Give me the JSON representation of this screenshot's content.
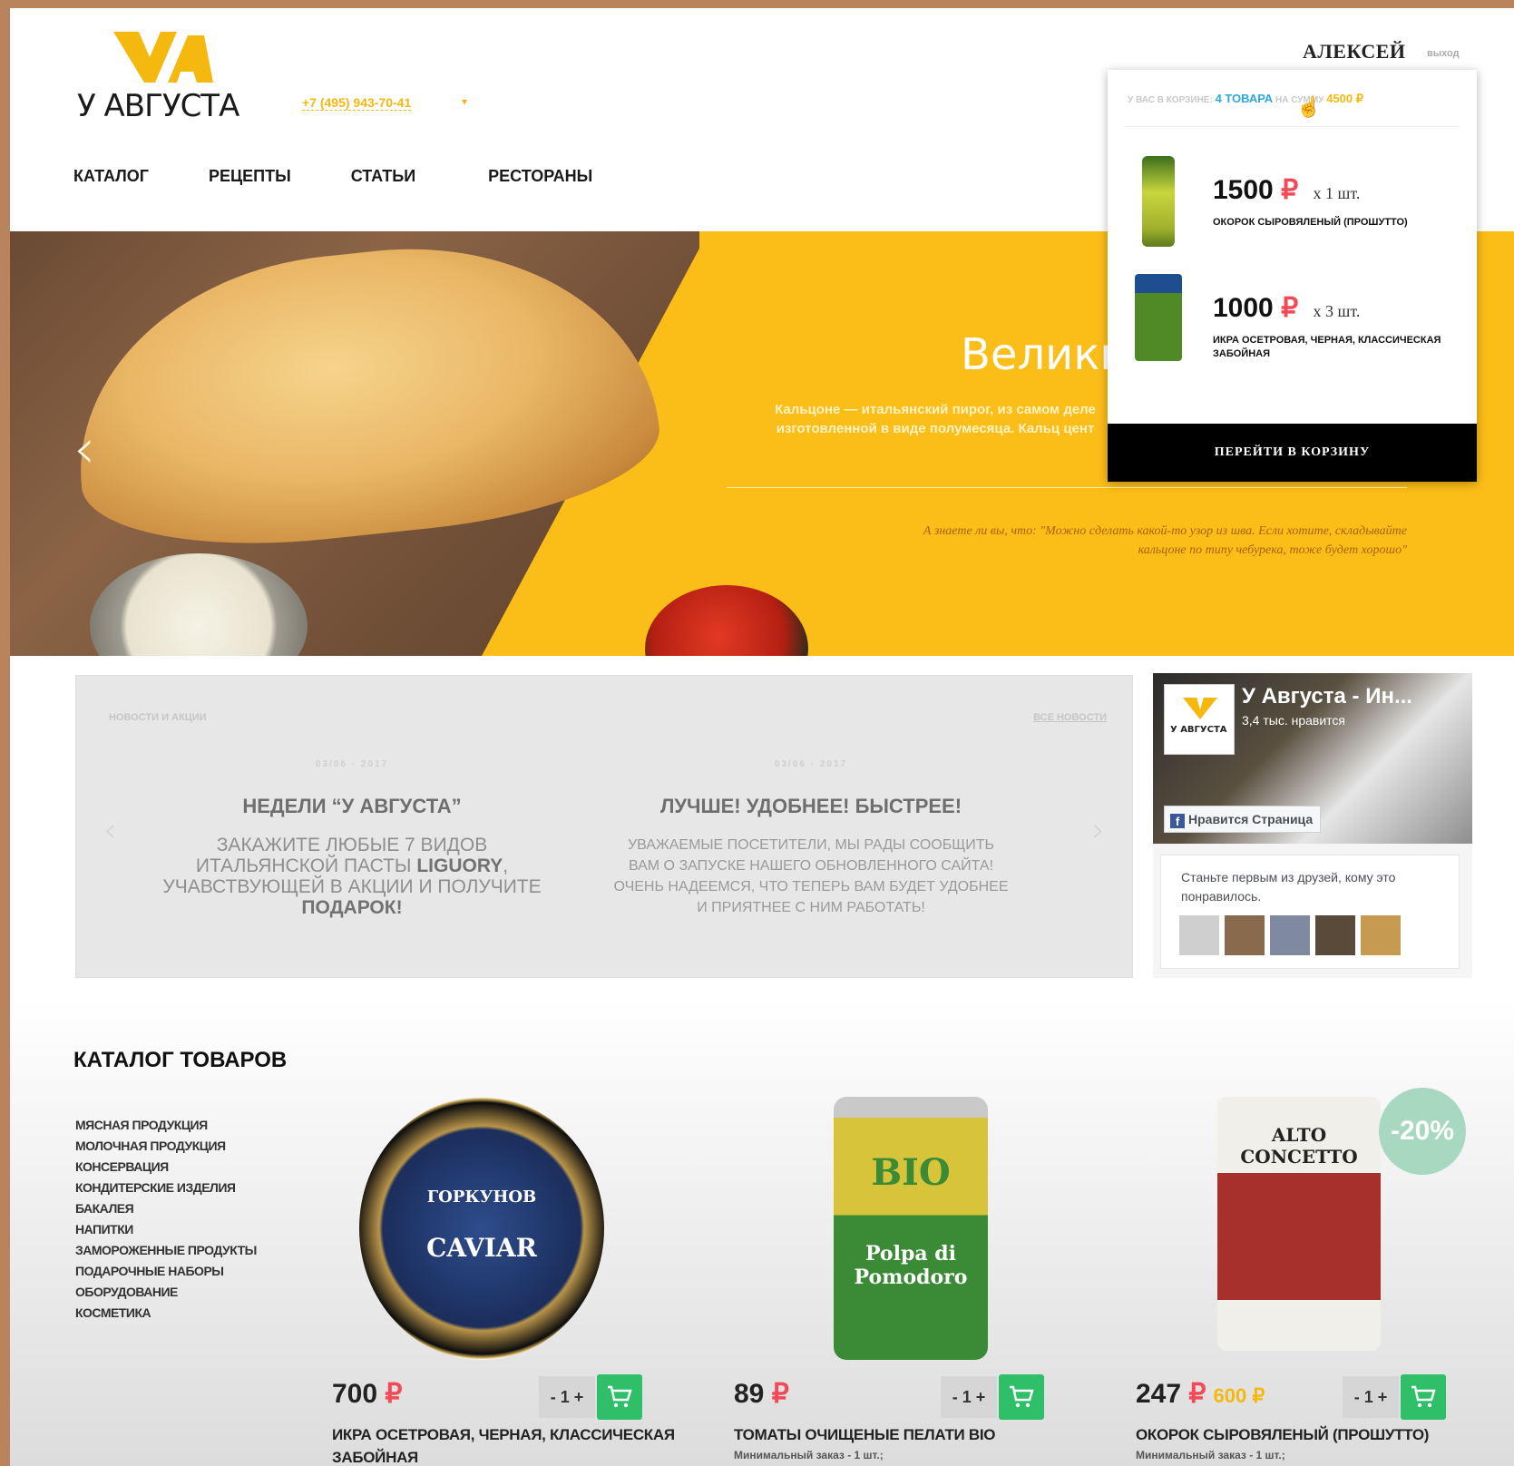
{
  "header": {
    "logo_text": "У АВГУСТА",
    "phone": "+7 (495) 943-70-41",
    "phone_caret": "▾",
    "user_name": "АЛЕКСЕЙ",
    "logout": "выход",
    "nav": [
      "КАТАЛОГ",
      "РЕЦЕПТЫ",
      "СТАТЬИ",
      "РЕСТОРАНЫ"
    ]
  },
  "hero": {
    "arrow_left": "‹",
    "title": "Велики",
    "text": "Кальцоне — итальянский пирог, из самом деле изготовленной в виде полумесяца. Кальц цент",
    "quote": "А знаете ли вы, что: \"Можно сделать какой-то узор из шва. Если хотите, складывайте кальцоне по типу чебурека, тоже будет хорошо\""
  },
  "cart": {
    "summary_prefix": "У ВАС В КОРЗИНЕ:",
    "count": "4 ТОВАРА",
    "summary_mid": "НА СУММУ",
    "total": "4500 ₽",
    "items": [
      {
        "price": "1500",
        "currency": "₽",
        "qty": "x 1 шт.",
        "name": "ОКОРОК СЫРОВЯЛЕНЫЙ (ПРОШУТТО)"
      },
      {
        "price": "1000",
        "currency": "₽",
        "qty": "x 3 шт.",
        "name": "ИКРА ОСЕТРОВАЯ, ЧЕРНАЯ, КЛАССИЧЕСКАЯ ЗАБОЙНАЯ"
      }
    ],
    "checkout_label": "ПЕРЕЙТИ В КОРЗИНУ"
  },
  "news": {
    "heading": "НОВОСТИ И АКЦИИ",
    "all_link": "ВСЕ НОВОСТИ",
    "arrow_left": "‹",
    "arrow_right": "›",
    "items": [
      {
        "date": "03/06 · 2017",
        "title": "НЕДЕЛИ “У АВГУСТА”",
        "text_a": "ЗАКАЖИТЕ ЛЮБЫЕ 7 ВИДОВ ИТАЛЬЯНСКОЙ ПАСТЫ ",
        "text_b": "LIGUORY",
        "text_c": ", УЧАВСТВУЮЩЕЙ В АКЦИИ И ПОЛУЧИТЕ ",
        "text_d": "ПОДАРОК!"
      },
      {
        "date": "03/06 · 2017",
        "title": "ЛУЧШЕ!  УДОБНЕЕ!  БЫСТРЕЕ!",
        "text": "УВАЖАЕМЫЕ ПОСЕТИТЕЛИ, МЫ РАДЫ СООБЩИТЬ ВАМ О ЗАПУСКЕ НАШЕГО ОБНОВЛЕННОГО САЙТА! ОЧЕНЬ НАДЕЕМСЯ, ЧТО ТЕПЕРЬ ВАМ БУДЕТ УДОБНЕЕ И ПРИЯТНЕЕ С НИМ РАБОТАТЬ!"
      }
    ]
  },
  "facebook": {
    "logo_text": "У АВГУСТА",
    "title": "У Августа - Ин...",
    "likes": "3,4 тыс. нравится",
    "like_button": "Нравится Страница",
    "friends_text": "Станьте первым из друзей, кому это понравилось."
  },
  "catalog": {
    "title": "КАТАЛОГ ТОВАРОВ",
    "categories": [
      "МЯСНАЯ ПРОДУКЦИЯ",
      "МОЛОЧНАЯ ПРОДУКЦИЯ",
      "КОНСЕРВАЦИЯ",
      "КОНДИТЕРСКИЕ ИЗДЕЛИЯ",
      "БАКАЛЕЯ",
      "НАПИТКИ",
      "ЗАМОРОЖЕННЫЕ ПРОДУКТЫ",
      "ПОДАРОЧНЫЕ НАБОРЫ",
      "ОБОРУДОВАНИЕ",
      "КОСМЕТИКА"
    ],
    "products": [
      {
        "label_top": "ГОРКУНОВ",
        "label_bottom": "CAVIAR",
        "price": "700",
        "currency": "₽",
        "old_price": "",
        "qty": "- 1 +",
        "name": "ИКРА ОСЕТРОВАЯ, ЧЕРНАЯ, КЛАССИЧЕСКАЯ ЗАБОЙНАЯ",
        "min_order": ""
      },
      {
        "label_top": "BIO",
        "label_bottom": "Polpa di Pomodoro",
        "price": "89",
        "currency": "₽",
        "old_price": "",
        "qty": "- 1 +",
        "name": "ТОМАТЫ ОЧИЩЕНЫЕ ПЕЛАТИ BIO",
        "min_order": "Минимальный заказ - 1 шт.;"
      },
      {
        "label_top": "ALTO CONCETTO",
        "label_bottom": "",
        "price": "247",
        "currency": "₽",
        "old_price": "600 ₽",
        "discount": "-20%",
        "qty": "- 1 +",
        "name": "ОКОРОК СЫРОВЯЛЕНЫЙ (ПРОШУТТО)",
        "min_order": "Минимальный заказ - 1 шт.;"
      }
    ]
  },
  "colors": {
    "brand_yellow": "#fbbd17",
    "accent_red": "#f24a56",
    "cart_green": "#2fbf68",
    "link_blue": "#2ba8e0"
  }
}
